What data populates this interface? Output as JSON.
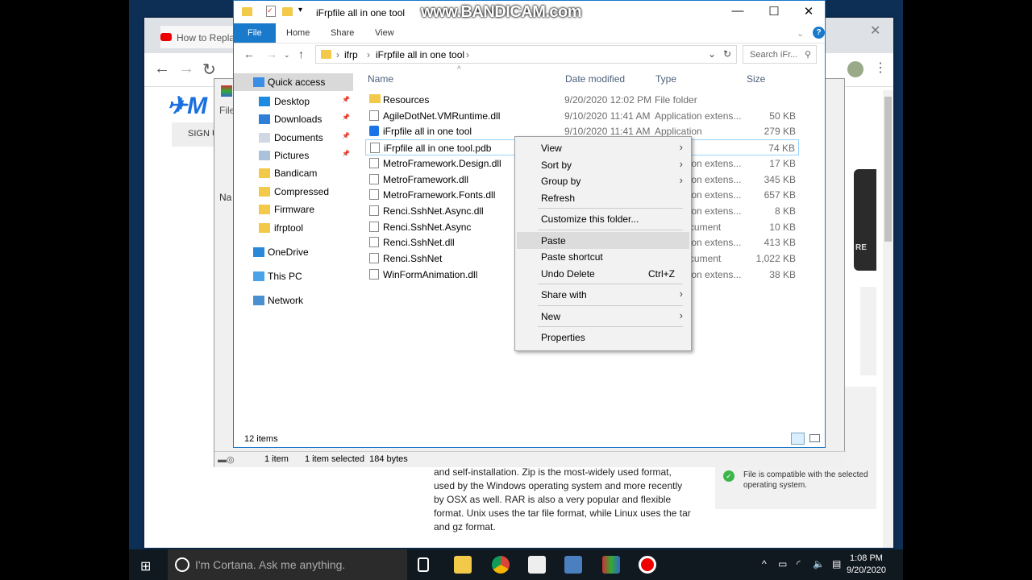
{
  "watermark": "www.BANDICAM.com",
  "browser": {
    "tab_title": "How to Repla",
    "signup": "SIGN U",
    "paragraph": "and self-installation. Zip is the most-widely used format, used by the Windows operating system and more recently by OSX as well. RAR is also a very popular and flexible format. Unix uses the tar file format, while Linux uses the tar and gz format.",
    "compat": "File is compatible with the selected operating system.",
    "button_partial": "RE"
  },
  "winrar": {
    "status_items": "1 item",
    "status_selected": "1 item selected  184 bytes",
    "file_menu": "File",
    "name_col": "Na"
  },
  "explorer": {
    "title": "iFrpfile all in one tool",
    "ribbon": {
      "file": "File",
      "home": "Home",
      "share": "Share",
      "view": "View"
    },
    "breadcrumb": [
      "ifrp",
      "iFrpfile all in one tool"
    ],
    "search_placeholder": "Search iFr...",
    "nav": [
      {
        "label": "Quick access",
        "icon": "star-icon"
      },
      {
        "label": "Desktop",
        "icon": "desktop-icon",
        "pinned": true
      },
      {
        "label": "Downloads",
        "icon": "download-icon",
        "pinned": true
      },
      {
        "label": "Documents",
        "icon": "documents-icon",
        "pinned": true
      },
      {
        "label": "Pictures",
        "icon": "pictures-icon",
        "pinned": true
      },
      {
        "label": "Bandicam",
        "icon": "folder-icon"
      },
      {
        "label": "Compressed",
        "icon": "folder-icon"
      },
      {
        "label": "Firmware",
        "icon": "folder-icon"
      },
      {
        "label": "ifrptool",
        "icon": "folder-icon"
      },
      {
        "label": "OneDrive",
        "icon": "cloud-icon"
      },
      {
        "label": "This PC",
        "icon": "pc-icon"
      },
      {
        "label": "Network",
        "icon": "network-icon"
      }
    ],
    "columns": {
      "name": "Name",
      "date": "Date modified",
      "type": "Type",
      "size": "Size"
    },
    "files": [
      {
        "name": "Resources",
        "date": "9/20/2020 12:02 PM",
        "type": "File folder",
        "size": "",
        "icon": "folder-icon"
      },
      {
        "name": "AgileDotNet.VMRuntime.dll",
        "date": "9/10/2020 11:41 AM",
        "type": "Application extens...",
        "size": "50 KB",
        "icon": "dll-icon"
      },
      {
        "name": "iFrpfile all in one tool",
        "date": "9/10/2020 11:41 AM",
        "type": "Application",
        "size": "279 KB",
        "icon": "app-icon"
      },
      {
        "name": "iFrpfile all in one tool.pdb",
        "date": "",
        "type": "",
        "size": "74 KB",
        "icon": "file-icon"
      },
      {
        "name": "MetroFramework.Design.dll",
        "date": "",
        "type": "Application extens...",
        "size": "17 KB",
        "icon": "dll-icon"
      },
      {
        "name": "MetroFramework.dll",
        "date": "",
        "type": "Application extens...",
        "size": "345 KB",
        "icon": "dll-icon"
      },
      {
        "name": "MetroFramework.Fonts.dll",
        "date": "",
        "type": "Application extens...",
        "size": "657 KB",
        "icon": "dll-icon"
      },
      {
        "name": "Renci.SshNet.Async.dll",
        "date": "",
        "type": "Application extens...",
        "size": "8 KB",
        "icon": "dll-icon"
      },
      {
        "name": "Renci.SshNet.Async",
        "date": "",
        "type": "XML Document",
        "size": "10 KB",
        "icon": "xml-icon"
      },
      {
        "name": "Renci.SshNet.dll",
        "date": "",
        "type": "Application extens...",
        "size": "413 KB",
        "icon": "dll-icon"
      },
      {
        "name": "Renci.SshNet",
        "date": "",
        "type": "XML Document",
        "size": "1,022 KB",
        "icon": "xml-icon"
      },
      {
        "name": "WinFormAnimation.dll",
        "date": "",
        "type": "Application extens...",
        "size": "38 KB",
        "icon": "dll-icon"
      }
    ],
    "selected_index": 3,
    "status": "12 items"
  },
  "context_menu": [
    {
      "label": "View",
      "submenu": true
    },
    {
      "label": "Sort by",
      "submenu": true
    },
    {
      "label": "Group by",
      "submenu": true
    },
    {
      "label": "Refresh"
    },
    {
      "sep": true
    },
    {
      "label": "Customize this folder..."
    },
    {
      "sep": true
    },
    {
      "label": "Paste",
      "highlighted": true
    },
    {
      "label": "Paste shortcut"
    },
    {
      "label": "Undo Delete",
      "shortcut": "Ctrl+Z"
    },
    {
      "sep": true
    },
    {
      "label": "Share with",
      "submenu": true
    },
    {
      "sep": true
    },
    {
      "label": "New",
      "submenu": true
    },
    {
      "sep": true
    },
    {
      "label": "Properties"
    }
  ],
  "taskbar": {
    "cortana": "I'm Cortana. Ask me anything.",
    "time": "1:08 PM",
    "date": "9/20/2020"
  }
}
